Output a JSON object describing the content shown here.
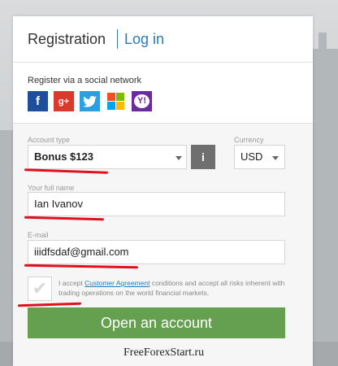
{
  "tabs": {
    "registration": "Registration",
    "login": "Log in"
  },
  "social": {
    "label": "Register via a social network",
    "icons": [
      {
        "name": "facebook-icon",
        "glyph": "f"
      },
      {
        "name": "google-plus-icon",
        "glyph": "g+"
      },
      {
        "name": "twitter-icon",
        "glyph": ""
      },
      {
        "name": "microsoft-icon",
        "glyph": ""
      },
      {
        "name": "yahoo-icon",
        "glyph": "Y!"
      }
    ]
  },
  "form": {
    "account_type": {
      "label": "Account type",
      "value": "Bonus $123"
    },
    "currency": {
      "label": "Currency",
      "value": "USD"
    },
    "info_glyph": "i",
    "full_name": {
      "label": "Your full name",
      "value": "Ian Ivanov"
    },
    "email": {
      "label": "E-mail",
      "value": "iiidfsdaf@gmail.com"
    },
    "accept": {
      "before": "I accept ",
      "link": "Customer Agreement",
      "after": " conditions and accept all risks inherent with trading operations on the world financial markets."
    },
    "submit": "Open an account"
  },
  "watermark": "FreeForexStart.ru",
  "colors": {
    "accent": "#2a7ab8",
    "button_green": "#64a04f",
    "annotation_red": "#e0101c"
  }
}
